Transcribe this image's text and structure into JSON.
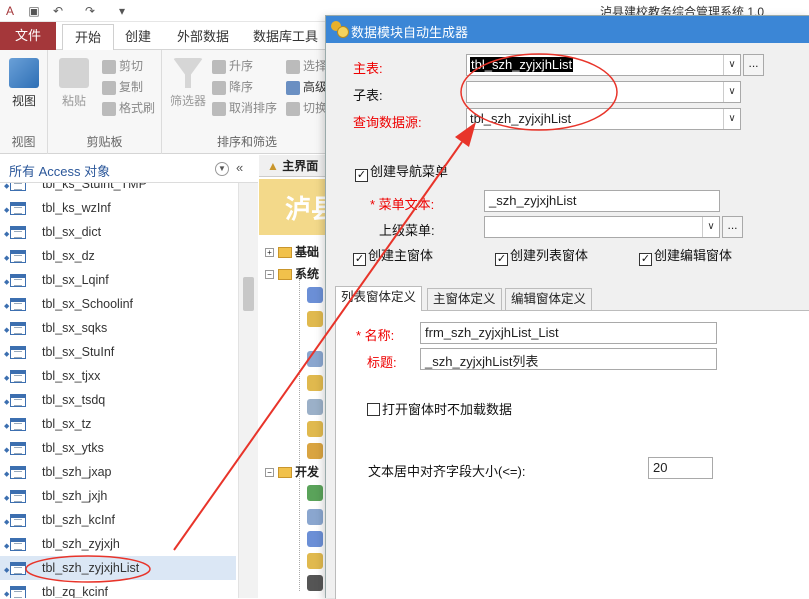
{
  "app": {
    "title": "泸县建校教务综合管理系统 1.0",
    "qat": [
      "save-icon",
      "undo-icon",
      "redo-icon",
      "customize-icon"
    ]
  },
  "tabs": [
    {
      "label": "文件"
    },
    {
      "label": "开始"
    },
    {
      "label": "创建"
    },
    {
      "label": "外部数据"
    },
    {
      "label": "数据库工具"
    }
  ],
  "ribbon": {
    "view_group": {
      "button": "视图",
      "label": "视图"
    },
    "clipboard_group": {
      "paste": "粘贴",
      "cut": "剪切",
      "copy": "复制",
      "format_painter": "格式刷",
      "label": "剪贴板"
    },
    "sort_group": {
      "filter": "筛选器",
      "asc": "升序",
      "desc": "降序",
      "clear_sort": "取消排序",
      "select": "选择",
      "advanced": "高级",
      "toggle": "切换",
      "label": "排序和筛选"
    }
  },
  "nav": {
    "title": "所有 Access 对象",
    "items": [
      {
        "label": "tbl_ks_Stuint_TMP"
      },
      {
        "label": "tbl_ks_wzInf"
      },
      {
        "label": "tbl_sx_dict"
      },
      {
        "label": "tbl_sx_dz"
      },
      {
        "label": "tbl_sx_Lqinf"
      },
      {
        "label": "tbl_sx_Schoolinf"
      },
      {
        "label": "tbl_sx_sqks"
      },
      {
        "label": "tbl_sx_StuInf"
      },
      {
        "label": "tbl_sx_tjxx"
      },
      {
        "label": "tbl_sx_tsdq"
      },
      {
        "label": "tbl_sx_tz"
      },
      {
        "label": "tbl_sx_ytks"
      },
      {
        "label": "tbl_szh_jxap"
      },
      {
        "label": "tbl_szh_jxjh"
      },
      {
        "label": "tbl_szh_kcInf"
      },
      {
        "label": "tbl_szh_zyjxjh"
      },
      {
        "label": "tbl_szh_zyjxjhList"
      },
      {
        "label": "tbl_zq_kcinf"
      }
    ]
  },
  "mainform": {
    "tab_title": "主界面",
    "banner": "泸县",
    "tree": [
      {
        "label": "基础"
      },
      {
        "label": "系统"
      },
      {
        "label": "开发"
      }
    ]
  },
  "rightbg": {
    "header": "#"
  },
  "dialog": {
    "title": "数据模块自动生成器",
    "main_table_label": "主表:",
    "main_table_value": "tbl_szh_zyjxjhList",
    "sub_table_label": "子表:",
    "sub_table_value": "",
    "query_source_label": "查询数据源:",
    "query_source_value": "tbl_szh_zyjxjhList",
    "create_nav_menu": "创建导航菜单",
    "menu_text_label": "* 菜单文本:",
    "menu_text_value": "_szh_zyjxjhList",
    "parent_menu_label": "上级菜单:",
    "parent_menu_value": "",
    "create_main_form": "创建主窗体",
    "create_list_form": "创建列表窗体",
    "create_edit_form": "创建编辑窗体",
    "tabs": [
      {
        "label": "列表窗体定义"
      },
      {
        "label": "主窗体定义"
      },
      {
        "label": "编辑窗体定义"
      }
    ],
    "list_form": {
      "name_label": "* 名称:",
      "name_value": "frm_szh_zyjxjhList_List",
      "caption_label": "标题:",
      "caption_value": "_szh_zyjxjhList列表",
      "no_load_on_open": "打开窗体时不加载数据",
      "align_size_label": "文本居中对齐字段大小(<=):",
      "align_size_value": "20"
    },
    "dots": "..."
  },
  "colors": {
    "file_tab": "#a4373a",
    "dialog_titlebar": "#3b86d6",
    "required_label": "#e00000",
    "annotation": "#e8342a",
    "nav_title": "#2b579a"
  }
}
